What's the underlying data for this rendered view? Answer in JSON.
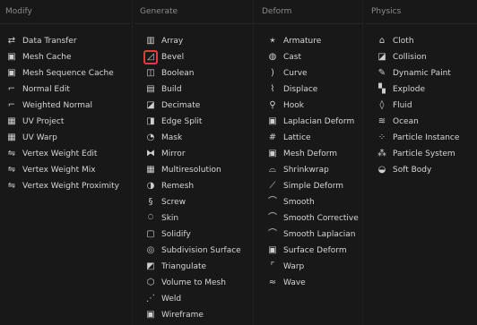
{
  "columns": {
    "modify": {
      "title": "Modify",
      "items": [
        {
          "label": "Data Transfer",
          "icon": "data-transfer-icon"
        },
        {
          "label": "Mesh Cache",
          "icon": "mesh-cache-icon"
        },
        {
          "label": "Mesh Sequence Cache",
          "icon": "mesh-sequence-cache-icon"
        },
        {
          "label": "Normal Edit",
          "icon": "normal-edit-icon"
        },
        {
          "label": "Weighted Normal",
          "icon": "weighted-normal-icon"
        },
        {
          "label": "UV Project",
          "icon": "uv-project-icon"
        },
        {
          "label": "UV Warp",
          "icon": "uv-warp-icon"
        },
        {
          "label": "Vertex Weight Edit",
          "icon": "vertex-weight-edit-icon"
        },
        {
          "label": "Vertex Weight Mix",
          "icon": "vertex-weight-mix-icon"
        },
        {
          "label": "Vertex Weight Proximity",
          "icon": "vertex-weight-proximity-icon"
        }
      ]
    },
    "generate": {
      "title": "Generate",
      "items": [
        {
          "label": "Array",
          "icon": "array-icon"
        },
        {
          "label": "Bevel",
          "icon": "bevel-icon"
        },
        {
          "label": "Boolean",
          "icon": "boolean-icon"
        },
        {
          "label": "Build",
          "icon": "build-icon"
        },
        {
          "label": "Decimate",
          "icon": "decimate-icon"
        },
        {
          "label": "Edge Split",
          "icon": "edge-split-icon"
        },
        {
          "label": "Mask",
          "icon": "mask-icon"
        },
        {
          "label": "Mirror",
          "icon": "mirror-icon"
        },
        {
          "label": "Multiresolution",
          "icon": "multiresolution-icon"
        },
        {
          "label": "Remesh",
          "icon": "remesh-icon"
        },
        {
          "label": "Screw",
          "icon": "screw-icon"
        },
        {
          "label": "Skin",
          "icon": "skin-icon"
        },
        {
          "label": "Solidify",
          "icon": "solidify-icon"
        },
        {
          "label": "Subdivision Surface",
          "icon": "subdivision-surface-icon"
        },
        {
          "label": "Triangulate",
          "icon": "triangulate-icon"
        },
        {
          "label": "Volume to Mesh",
          "icon": "volume-to-mesh-icon"
        },
        {
          "label": "Weld",
          "icon": "weld-icon"
        },
        {
          "label": "Wireframe",
          "icon": "wireframe-icon"
        }
      ]
    },
    "deform": {
      "title": "Deform",
      "items": [
        {
          "label": "Armature",
          "icon": "armature-icon"
        },
        {
          "label": "Cast",
          "icon": "cast-icon"
        },
        {
          "label": "Curve",
          "icon": "curve-icon"
        },
        {
          "label": "Displace",
          "icon": "displace-icon"
        },
        {
          "label": "Hook",
          "icon": "hook-icon"
        },
        {
          "label": "Laplacian Deform",
          "icon": "laplacian-deform-icon"
        },
        {
          "label": "Lattice",
          "icon": "lattice-icon"
        },
        {
          "label": "Mesh Deform",
          "icon": "mesh-deform-icon"
        },
        {
          "label": "Shrinkwrap",
          "icon": "shrinkwrap-icon"
        },
        {
          "label": "Simple Deform",
          "icon": "simple-deform-icon"
        },
        {
          "label": "Smooth",
          "icon": "smooth-icon"
        },
        {
          "label": "Smooth Corrective",
          "icon": "smooth-corrective-icon"
        },
        {
          "label": "Smooth Laplacian",
          "icon": "smooth-laplacian-icon"
        },
        {
          "label": "Surface Deform",
          "icon": "surface-deform-icon"
        },
        {
          "label": "Warp",
          "icon": "warp-icon"
        },
        {
          "label": "Wave",
          "icon": "wave-icon"
        }
      ]
    },
    "physics": {
      "title": "Physics",
      "items": [
        {
          "label": "Cloth",
          "icon": "cloth-icon"
        },
        {
          "label": "Collision",
          "icon": "collision-icon"
        },
        {
          "label": "Dynamic Paint",
          "icon": "dynamic-paint-icon"
        },
        {
          "label": "Explode",
          "icon": "explode-icon"
        },
        {
          "label": "Fluid",
          "icon": "fluid-icon"
        },
        {
          "label": "Ocean",
          "icon": "ocean-icon"
        },
        {
          "label": "Particle Instance",
          "icon": "particle-instance-icon"
        },
        {
          "label": "Particle System",
          "icon": "particle-system-icon"
        },
        {
          "label": "Soft Body",
          "icon": "soft-body-icon"
        }
      ]
    }
  },
  "highlight_color": "#e23b3b"
}
